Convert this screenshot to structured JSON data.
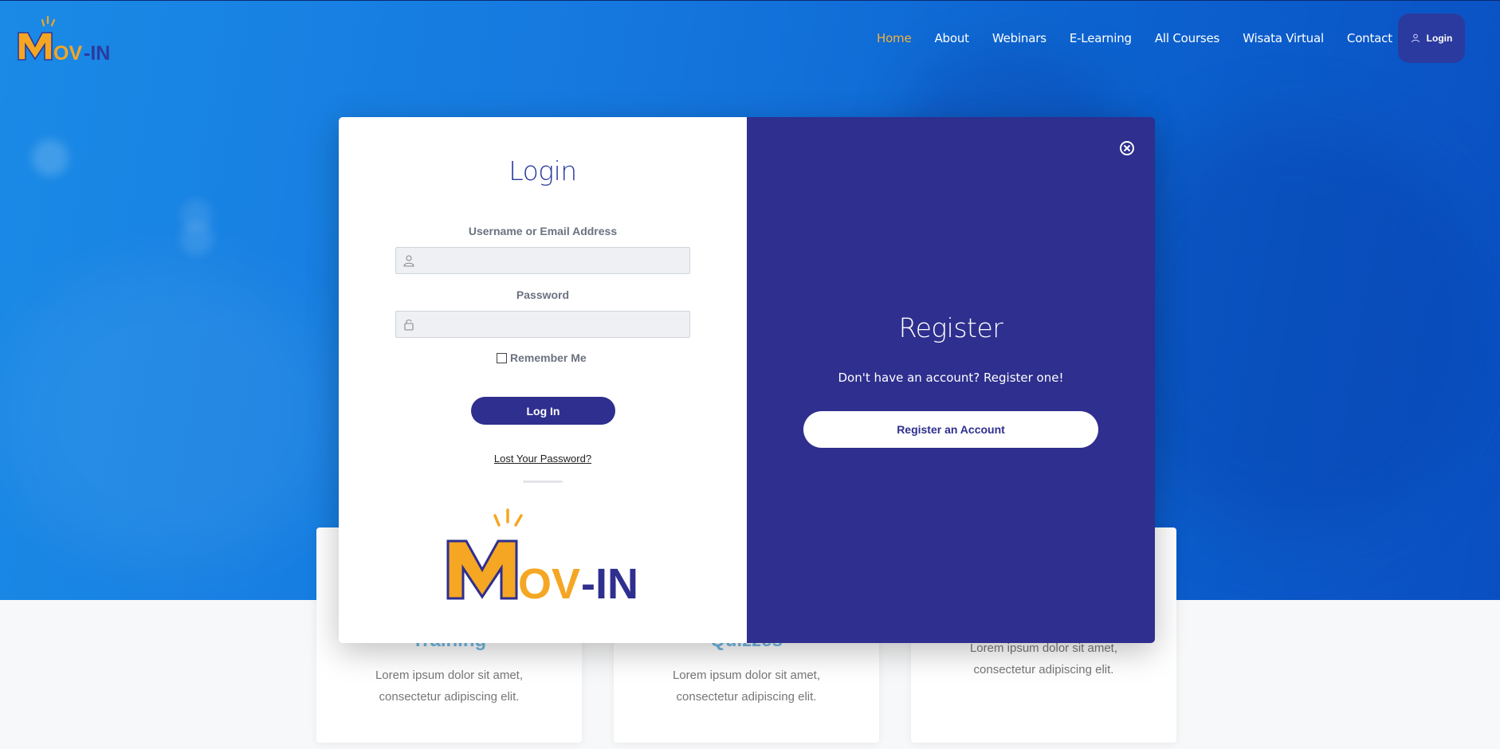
{
  "brand": {
    "logo_text": "MOV-IN"
  },
  "nav": {
    "items": [
      {
        "label": "Home",
        "active": true
      },
      {
        "label": "About"
      },
      {
        "label": "Webinars"
      },
      {
        "label": "E-Learning"
      },
      {
        "label": "All Courses"
      },
      {
        "label": "Wisata Virtual"
      },
      {
        "label": "Contact"
      }
    ],
    "login_label": "Login",
    "active_color": "#f3b33d"
  },
  "cards": [
    {
      "title": "Training",
      "text_line1": "Lorem ipsum dolor sit amet,",
      "text_line2": "consectetur adipiscing elit."
    },
    {
      "title": "Quizzes",
      "text_line1": "Lorem ipsum dolor sit amet,",
      "text_line2": "consectetur adipiscing elit."
    },
    {
      "title": "",
      "text_line1": "Lorem ipsum dolor sit amet,",
      "text_line2": "consectetur adipiscing elit."
    }
  ],
  "login_panel": {
    "title": "Login",
    "username_label": "Username or Email Address",
    "username_value": "",
    "password_label": "Password",
    "password_value": "",
    "remember_label": "Remember Me",
    "remember_checked": false,
    "submit_label": "Log In",
    "lost_password_label": "Lost Your Password?"
  },
  "register_panel": {
    "title": "Register",
    "text": "Don't have an account? Register one!",
    "button_label": "Register an Account"
  },
  "colors": {
    "primary": "#2e2f8e",
    "logo_orange": "#f5a623",
    "hero_blue": "#1577de"
  }
}
